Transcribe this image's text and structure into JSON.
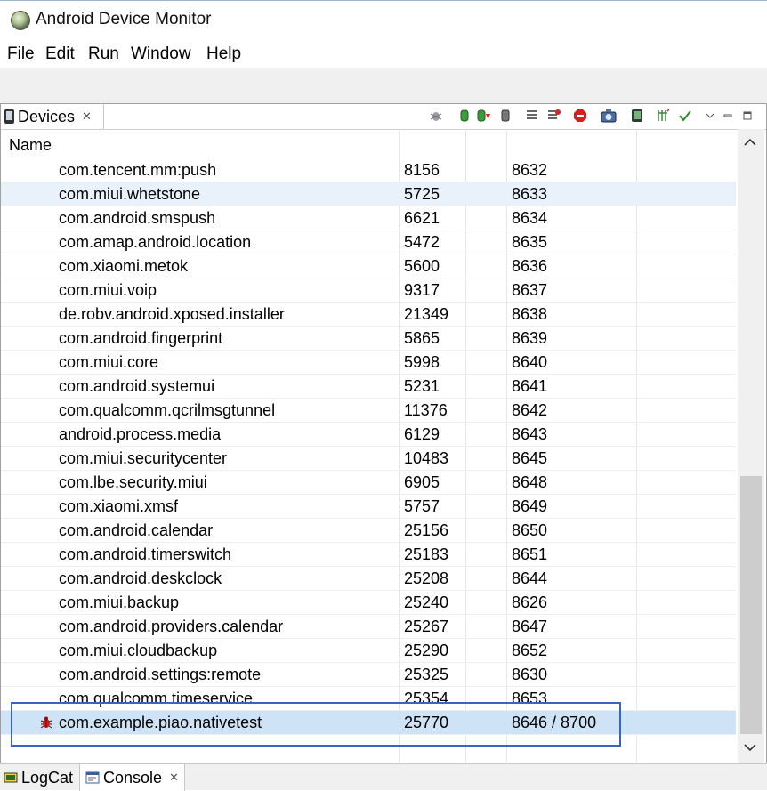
{
  "window": {
    "title": "Android Device Monitor"
  },
  "menu": [
    "File",
    "Edit",
    "Run",
    "Window",
    "Help"
  ],
  "devices_view": {
    "tab_label": "Devices",
    "header": {
      "name": "Name"
    },
    "rows": [
      {
        "name": "com.tencent.mm:push",
        "pid": "8156",
        "port": "8632"
      },
      {
        "name": "com.miui.whetstone",
        "pid": "5725",
        "port": "8633"
      },
      {
        "name": "com.android.smspush",
        "pid": "6621",
        "port": "8634"
      },
      {
        "name": "com.amap.android.location",
        "pid": "5472",
        "port": "8635"
      },
      {
        "name": "com.xiaomi.metok",
        "pid": "5600",
        "port": "8636"
      },
      {
        "name": "com.miui.voip",
        "pid": "9317",
        "port": "8637"
      },
      {
        "name": "de.robv.android.xposed.installer",
        "pid": "21349",
        "port": "8638"
      },
      {
        "name": "com.android.fingerprint",
        "pid": "5865",
        "port": "8639"
      },
      {
        "name": "com.miui.core",
        "pid": "5998",
        "port": "8640"
      },
      {
        "name": "com.android.systemui",
        "pid": "5231",
        "port": "8641"
      },
      {
        "name": "com.qualcomm.qcrilmsgtunnel",
        "pid": "11376",
        "port": "8642"
      },
      {
        "name": "android.process.media",
        "pid": "6129",
        "port": "8643"
      },
      {
        "name": "com.miui.securitycenter",
        "pid": "10483",
        "port": "8645"
      },
      {
        "name": "com.lbe.security.miui",
        "pid": "6905",
        "port": "8648"
      },
      {
        "name": "com.xiaomi.xmsf",
        "pid": "5757",
        "port": "8649"
      },
      {
        "name": "com.android.calendar",
        "pid": "25156",
        "port": "8650"
      },
      {
        "name": "com.android.timerswitch",
        "pid": "25183",
        "port": "8651"
      },
      {
        "name": "com.android.deskclock",
        "pid": "25208",
        "port": "8644"
      },
      {
        "name": "com.miui.backup",
        "pid": "25240",
        "port": "8626"
      },
      {
        "name": "com.android.providers.calendar",
        "pid": "25267",
        "port": "8647"
      },
      {
        "name": "com.miui.cloudbackup",
        "pid": "25290",
        "port": "8652"
      },
      {
        "name": "com.android.settings:remote",
        "pid": "25325",
        "port": "8630"
      },
      {
        "name": "com.qualcomm.timeservice",
        "pid": "25354",
        "port": "8653"
      },
      {
        "name": "com.example.piao.nativetest",
        "pid": "25770",
        "port": "8646 / 8700"
      }
    ]
  },
  "bottom_tabs": {
    "logcat": "LogCat",
    "console": "Console"
  },
  "colors": {
    "selection": "#cfe3f7",
    "highlight_box": "#3b63c6"
  }
}
